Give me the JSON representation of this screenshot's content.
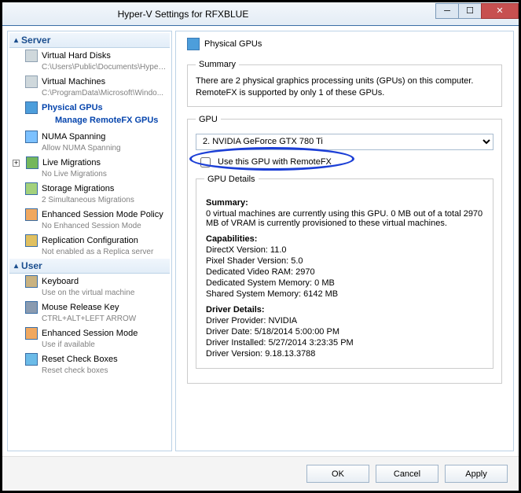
{
  "window": {
    "title": "Hyper-V Settings for RFXBLUE"
  },
  "sidebar": {
    "sections": [
      {
        "label": "Server",
        "items": [
          {
            "title": "Virtual Hard Disks",
            "sub": "C:\\Users\\Public\\Documents\\Hyper-..."
          },
          {
            "title": "Virtual Machines",
            "sub": "C:\\ProgramData\\Microsoft\\Windo..."
          },
          {
            "title": "Physical GPUs",
            "selected": true,
            "child": "Manage RemoteFX GPUs"
          },
          {
            "title": "NUMA Spanning",
            "sub": "Allow NUMA Spanning"
          },
          {
            "title": "Live Migrations",
            "sub": "No Live Migrations",
            "expandable": true
          },
          {
            "title": "Storage Migrations",
            "sub": "2 Simultaneous Migrations"
          },
          {
            "title": "Enhanced Session Mode Policy",
            "sub": "No Enhanced Session Mode"
          },
          {
            "title": "Replication Configuration",
            "sub": "Not enabled as a Replica server"
          }
        ]
      },
      {
        "label": "User",
        "items": [
          {
            "title": "Keyboard",
            "sub": "Use on the virtual machine"
          },
          {
            "title": "Mouse Release Key",
            "sub": "CTRL+ALT+LEFT ARROW"
          },
          {
            "title": "Enhanced Session Mode",
            "sub": "Use if available"
          },
          {
            "title": "Reset Check Boxes",
            "sub": "Reset check boxes"
          }
        ]
      }
    ]
  },
  "main": {
    "heading": "Physical GPUs",
    "summary": {
      "label": "Summary",
      "text": "There are 2 physical graphics processing units (GPUs) on this computer. RemoteFX is supported by only 1 of these GPUs."
    },
    "gpu": {
      "label": "GPU",
      "selected": "2. NVIDIA GeForce GTX 780 Ti"
    },
    "checkbox_label": "Use this GPU with RemoteFX",
    "details": {
      "label": "GPU Details",
      "summary_head": "Summary:",
      "summary_text": "0 virtual machines are currently using this GPU. 0 MB out of a total 2970 MB of VRAM is currently provisioned to these virtual machines.",
      "cap_head": "Capabilities:",
      "cap": {
        "dx": "DirectX Version: 11.0",
        "ps": "Pixel Shader Version: 5.0",
        "vram": "Dedicated Video RAM: 2970",
        "dsm": "Dedicated System Memory: 0 MB",
        "ssm": "Shared System Memory: 6142 MB"
      },
      "drv_head": "Driver Details:",
      "drv": {
        "provider": "Driver Provider: NVIDIA",
        "date": "Driver Date: 5/18/2014 5:00:00 PM",
        "installed": "Driver Installed: 5/27/2014 3:23:35 PM",
        "version": "Driver Version: 9.18.13.3788"
      }
    }
  },
  "buttons": {
    "ok": "OK",
    "cancel": "Cancel",
    "apply": "Apply"
  }
}
